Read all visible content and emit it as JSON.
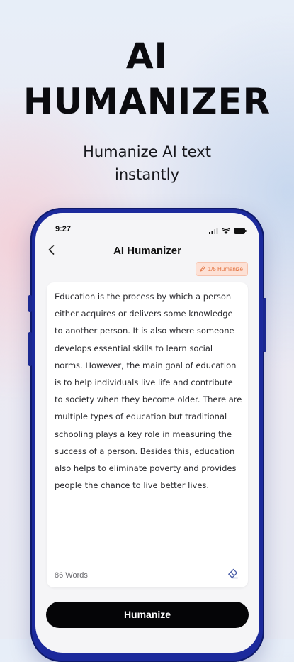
{
  "hero": {
    "title_line1": "AI",
    "title_line2": "HUMANIZER",
    "subtitle_line1": "Humanize AI text",
    "subtitle_line2": "instantly"
  },
  "status_bar": {
    "time": "9:27",
    "icons": [
      "signal-icon",
      "wifi-icon",
      "battery-icon"
    ]
  },
  "nav": {
    "back_icon": "chevron-left-icon",
    "title": "AI Humanizer"
  },
  "usage_badge": {
    "icon": "pencil-icon",
    "label": "1/5 Humanize"
  },
  "editor": {
    "text": "Education is the process by which a person either acquires or delivers some knowledge to another person. It is also where someone develops essential skills to learn social norms. However, the main goal of education is to help individuals live life and contribute to society when they become older. There are multiple types of education but traditional schooling plays a key role in measuring the success of a person. Besides this, education also helps to eliminate poverty and provides people the chance to live better lives.",
    "word_count": "86 Words",
    "clear_icon": "eraser-icon"
  },
  "actions": {
    "humanize_label": "Humanize"
  },
  "colors": {
    "frame": "#1c2a9c",
    "badge_bg": "#fde1d6",
    "badge_text": "#e2723f",
    "button_bg": "#050507"
  }
}
